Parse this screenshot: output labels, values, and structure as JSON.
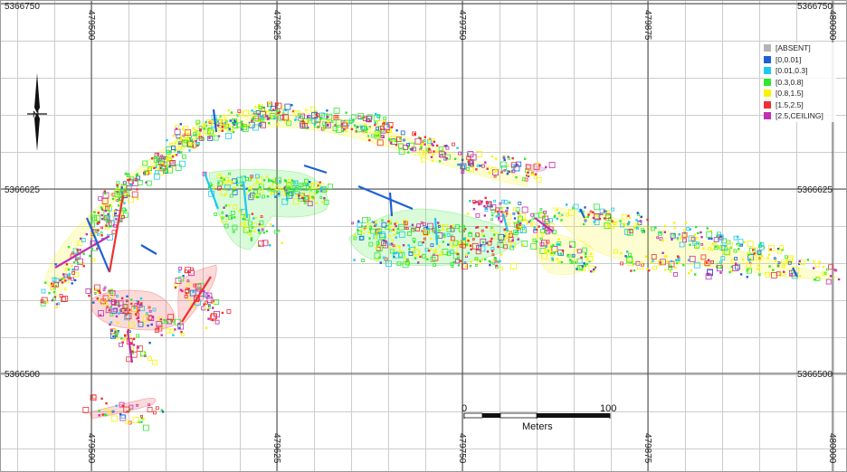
{
  "map": {
    "x_ticks": [
      "479500",
      "479625",
      "479750",
      "479875",
      "480000"
    ],
    "y_ticks": [
      "5366750",
      "5366625",
      "5366500"
    ],
    "scale_bar": {
      "start_label": "0",
      "end_label": "100",
      "unit_label": "Meters"
    },
    "north_label": "N"
  },
  "legend": {
    "items": [
      {
        "label": "[ABSENT]",
        "color": "#b4b4b4"
      },
      {
        "label": "[0,0.01]",
        "color": "#1f5fd6"
      },
      {
        "label": "[0.01,0.3]",
        "color": "#1ec8f0"
      },
      {
        "label": "[0.3,0.8]",
        "color": "#2ee82e"
      },
      {
        "label": "[0.8,1.5]",
        "color": "#f5f500"
      },
      {
        "label": "[1.5,2.5]",
        "color": "#f03030"
      },
      {
        "label": "[2.5,CEILING]",
        "color": "#c030b0"
      }
    ]
  }
}
